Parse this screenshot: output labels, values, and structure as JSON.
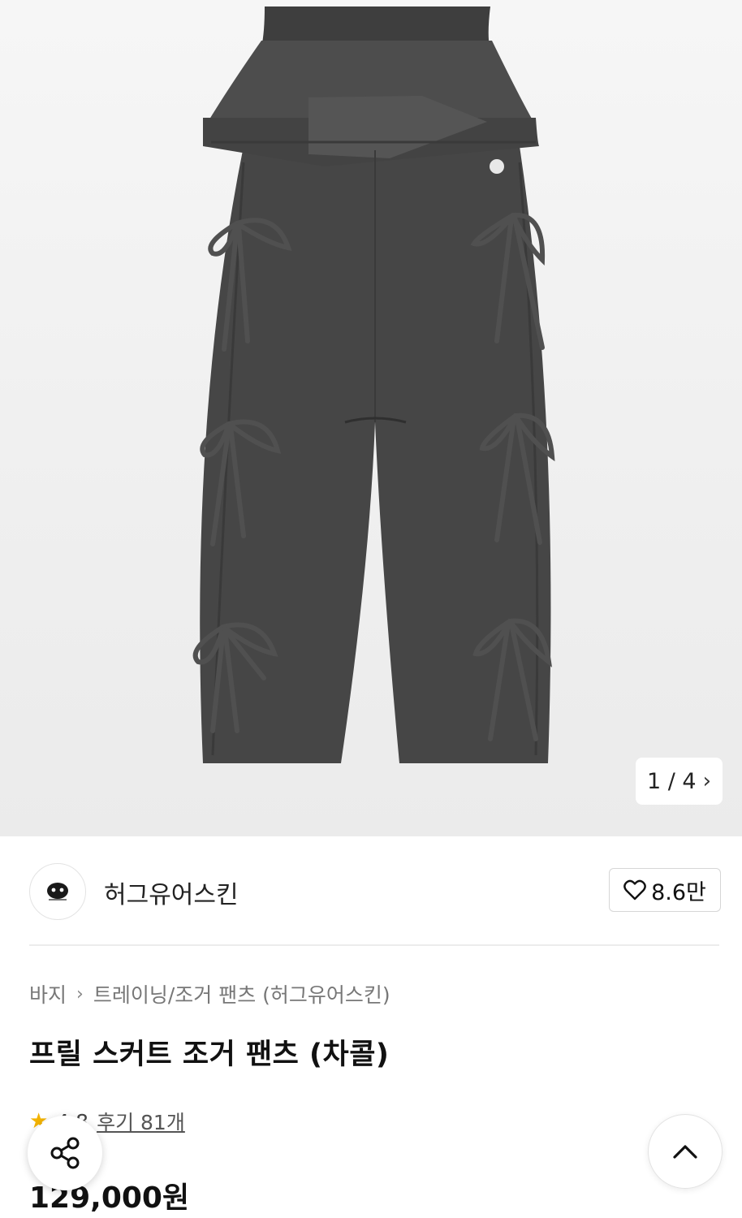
{
  "gallery": {
    "counter_text": "1 / 4",
    "next_glyph": "›",
    "image_subject": "charcoal-frill-skirt-jogger-pants"
  },
  "brand": {
    "name": "허그유어스킨",
    "logo_icon": "brand-logo-icon",
    "like_count": "8.6만",
    "like_icon": "heart-outline-icon"
  },
  "breadcrumb": {
    "items": [
      "바지",
      "트레이닝/조거 팬츠 (허그유어스킨)"
    ],
    "separator": "›"
  },
  "product": {
    "title": "프릴 스커트 조거 팬츠 (차콜)",
    "rating": "4.8",
    "review_link": "후기 81개",
    "price": "129,000원"
  },
  "floating": {
    "share_icon": "share-icon",
    "scroll_top_icon": "chevron-up-icon"
  },
  "colors": {
    "star": "#f3b300",
    "pants": "#454545",
    "background": "#ffffff"
  }
}
